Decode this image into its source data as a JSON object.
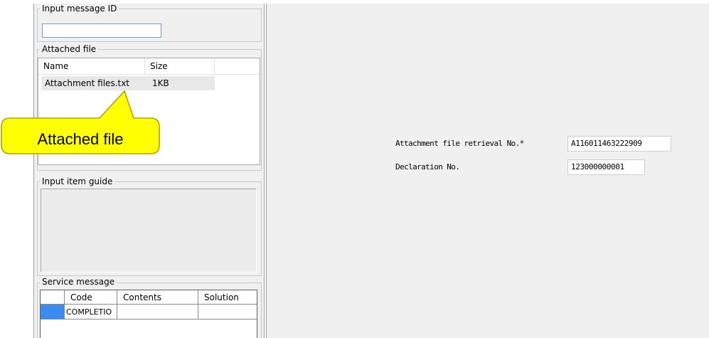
{
  "left_panel": {
    "input_message_id": {
      "legend": "Input message ID",
      "value": ""
    },
    "attached_file": {
      "legend": "Attached file",
      "columns": [
        "Name",
        "Size"
      ],
      "rows": [
        {
          "name": "Attachment files.txt",
          "size": "1KB"
        }
      ]
    },
    "input_item_guide": {
      "legend": "Input item guide"
    },
    "service_message": {
      "legend": "Service message",
      "columns": [
        "Code",
        "Contents",
        "Solution"
      ],
      "rows": [
        {
          "code": "COMPLETIO",
          "contents": "",
          "solution": ""
        }
      ]
    }
  },
  "form": {
    "fields": [
      {
        "label": "Attachment file retrieval No.*",
        "value": "A116011463222909"
      },
      {
        "label": "Declaration No.",
        "value": "123000000001"
      }
    ]
  },
  "callout": {
    "text": "Attached file",
    "fill": "#ffff00",
    "stroke": "#b8a000"
  },
  "colors": {
    "selection": "#3c8cf0",
    "panel_bg": "#f0f0f0"
  }
}
